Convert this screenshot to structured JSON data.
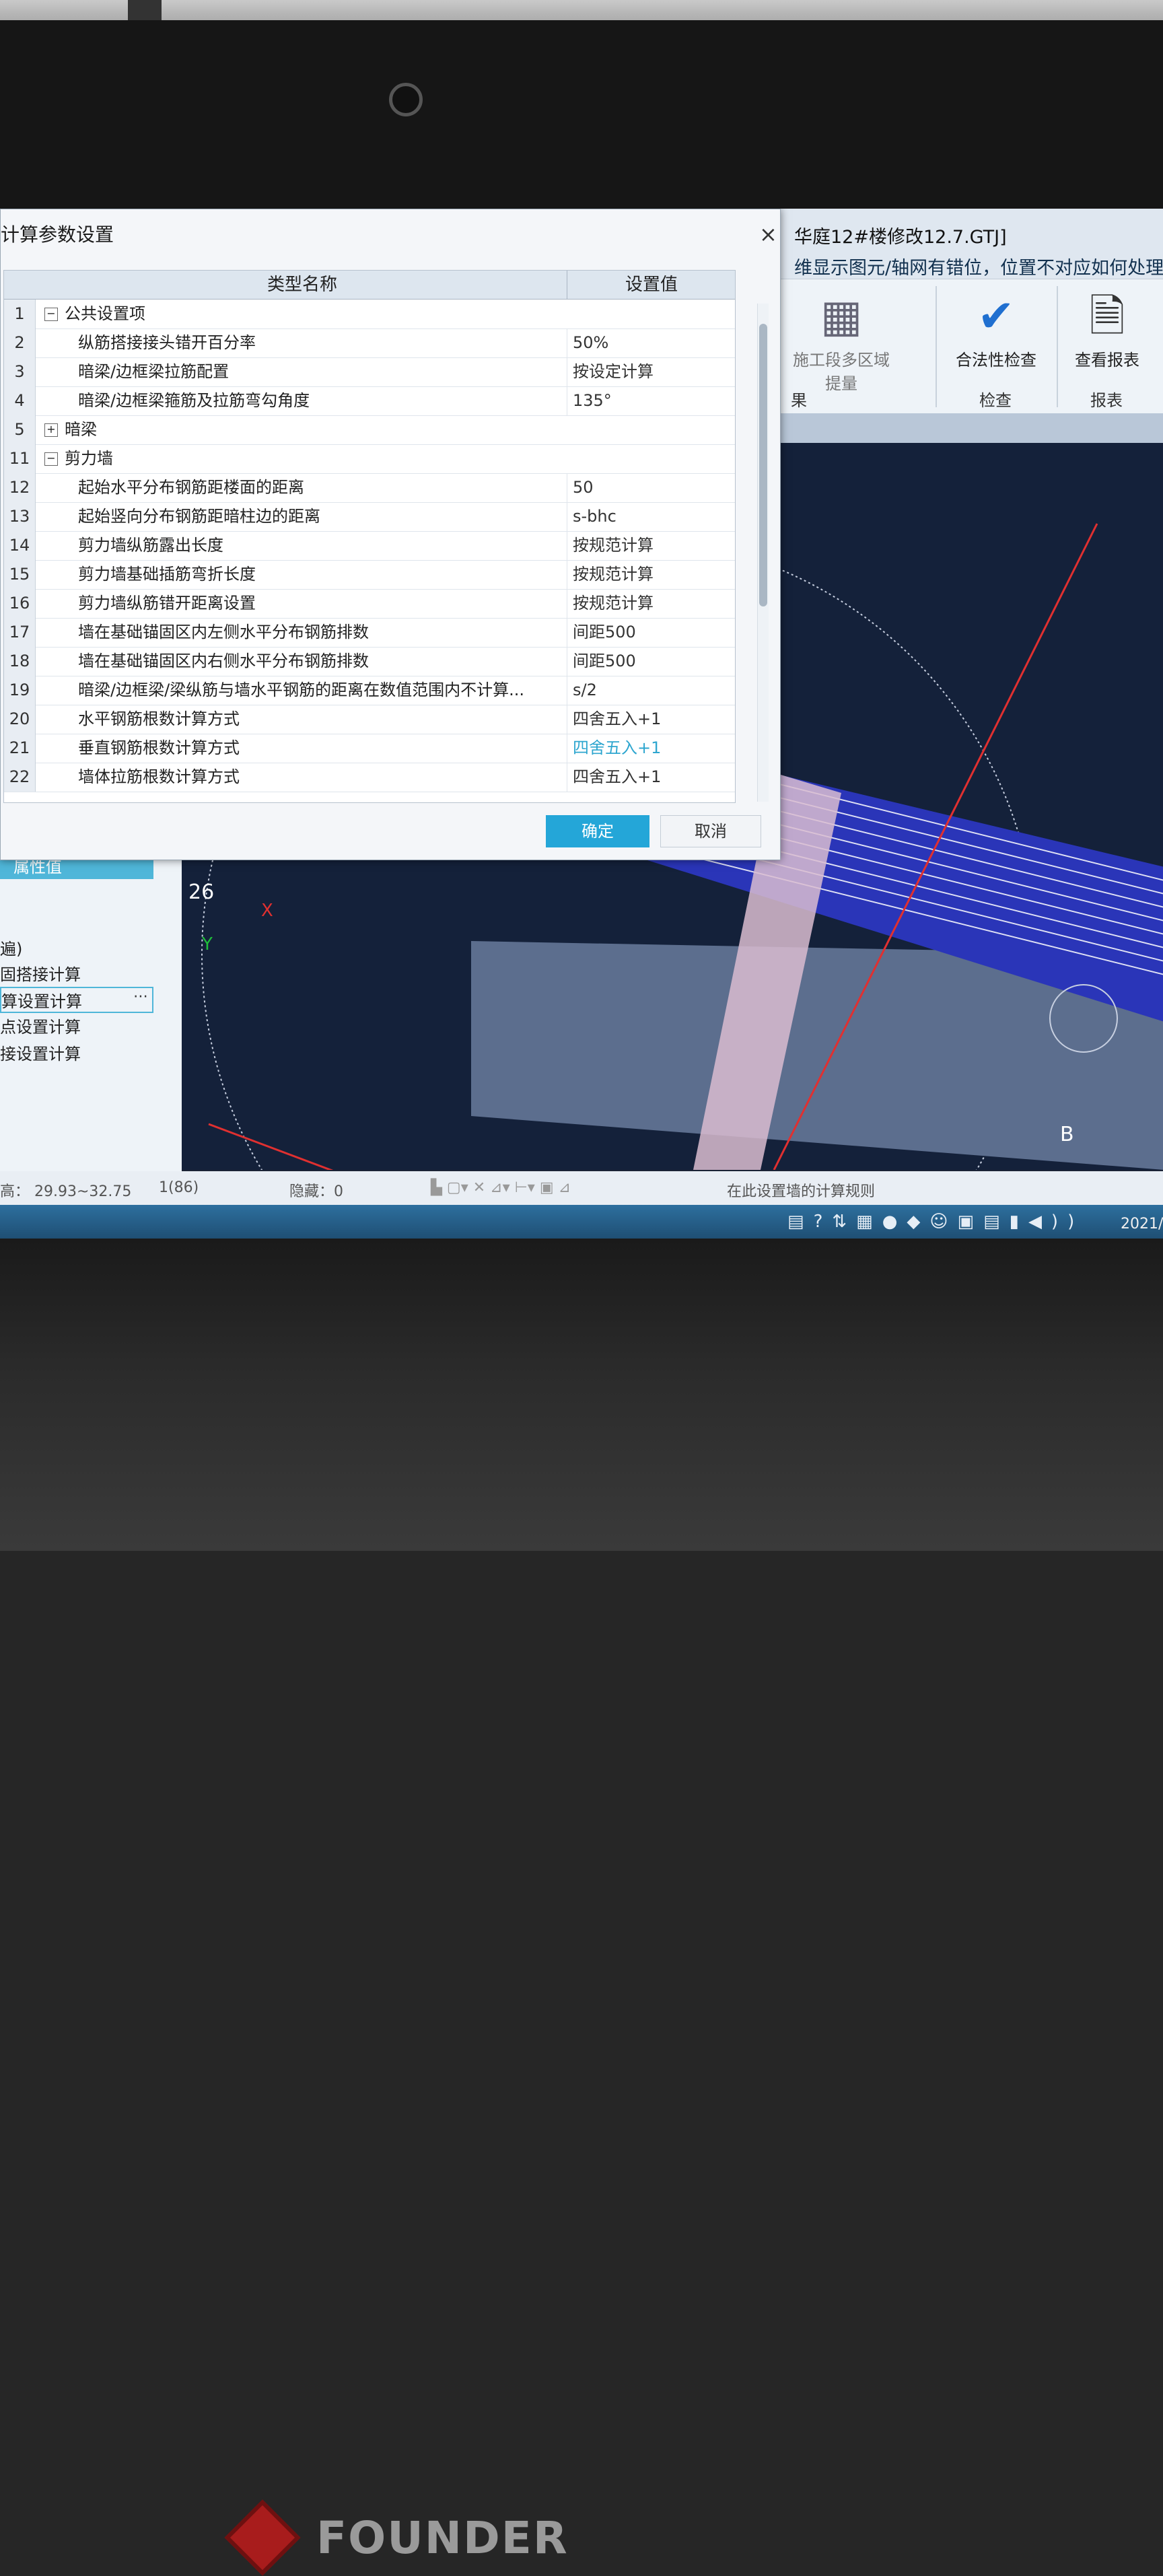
{
  "app": {
    "title": "华庭12#楼修改12.7.GTJ]",
    "question": "维显示图元/轴网有错位，位置不对应如何处理？",
    "ribbon": {
      "btn_area": "施工段多区域提量",
      "btn_check": "合法性检查",
      "btn_report": "查看报表",
      "group_left": "果",
      "group_check": "检查",
      "group_report": "报表"
    }
  },
  "dialog": {
    "title": "计算参数设置",
    "close_icon": "×",
    "columns": {
      "name": "类型名称",
      "value": "设置值"
    },
    "rows": [
      {
        "num": "1",
        "name": "公共设置项",
        "value": "",
        "tree": "−",
        "indent": 0
      },
      {
        "num": "2",
        "name": "纵筋搭接接头错开百分率",
        "value": "50%",
        "tree": "",
        "indent": 1
      },
      {
        "num": "3",
        "name": "暗梁/边框梁拉筋配置",
        "value": "按设定计算",
        "tree": "",
        "indent": 1
      },
      {
        "num": "4",
        "name": "暗梁/边框梁箍筋及拉筋弯勾角度",
        "value": "135°",
        "tree": "",
        "indent": 1
      },
      {
        "num": "5",
        "name": "暗梁",
        "value": "",
        "tree": "+",
        "indent": 0
      },
      {
        "num": "11",
        "name": "剪力墙",
        "value": "",
        "tree": "−",
        "indent": 0
      },
      {
        "num": "12",
        "name": "起始水平分布钢筋距楼面的距离",
        "value": "50",
        "tree": "",
        "indent": 1
      },
      {
        "num": "13",
        "name": "起始竖向分布钢筋距暗柱边的距离",
        "value": "s-bhc",
        "tree": "",
        "indent": 1
      },
      {
        "num": "14",
        "name": "剪力墙纵筋露出长度",
        "value": "按规范计算",
        "tree": "",
        "indent": 1
      },
      {
        "num": "15",
        "name": "剪力墙基础插筋弯折长度",
        "value": "按规范计算",
        "tree": "",
        "indent": 1
      },
      {
        "num": "16",
        "name": "剪力墙纵筋错开距离设置",
        "value": "按规范计算",
        "tree": "",
        "indent": 1
      },
      {
        "num": "17",
        "name": "墙在基础锚固区内左侧水平分布钢筋排数",
        "value": "间距500",
        "tree": "",
        "indent": 1
      },
      {
        "num": "18",
        "name": "墙在基础锚固区内右侧水平分布钢筋排数",
        "value": "间距500",
        "tree": "",
        "indent": 1
      },
      {
        "num": "19",
        "name": "暗梁/边框梁/梁纵筋与墙水平钢筋的距离在数值范围内不计算...",
        "value": "s/2",
        "tree": "",
        "indent": 1
      },
      {
        "num": "20",
        "name": "水平钢筋根数计算方式",
        "value": "四舍五入+1",
        "tree": "",
        "indent": 1
      },
      {
        "num": "21",
        "name": "垂直钢筋根数计算方式",
        "value": "四舍五入+1",
        "tree": "",
        "indent": 1,
        "highlight": true
      },
      {
        "num": "22",
        "name": "墙体拉筋根数计算方式",
        "value": "四舍五入+1",
        "tree": "",
        "indent": 1
      }
    ],
    "ok_label": "确定",
    "cancel_label": "取消"
  },
  "left_panel": {
    "tab": "属性值",
    "items": [
      "固搭接计算",
      "算设置计算",
      "点设置计算",
      "接设置计算"
    ],
    "partial": "遍)"
  },
  "viewport": {
    "axis_label_26": "26",
    "axis_label_b": "B",
    "axis_x": "X",
    "axis_y": "Y"
  },
  "status": {
    "elevation": "高：  29.93~32.75",
    "count": "1(86)",
    "hidden": "隐藏：0",
    "hint": "在此设置墙的计算规则"
  },
  "taskbar": {
    "clock": "2021/"
  },
  "device": {
    "brand": "FOUNDER"
  },
  "colors": {
    "accent": "#24a6d8",
    "highlight_text": "#2ea6cf"
  }
}
